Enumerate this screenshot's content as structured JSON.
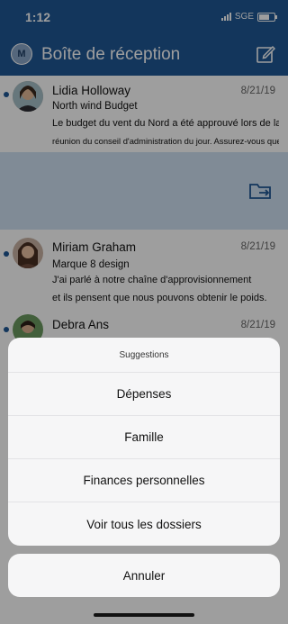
{
  "status_bar": {
    "time": "1:12",
    "carrier": "SGE"
  },
  "header": {
    "title": "Boîte de réception",
    "avatar_initial": "M"
  },
  "mails": [
    {
      "sender": "Lidia Holloway",
      "date": "8/21/19",
      "subject": "North wind Budget",
      "preview_line1": "Le budget du vent du Nord a été approuvé lors de la",
      "preview_line2": "réunion du conseil d'administration du jour. Assurez-vous que le"
    },
    {
      "sender": "Miriam Graham",
      "date": "8/21/19",
      "subject": "Marque 8 design",
      "preview_line1": "J'ai parlé à notre chaîne d'approvisionnement",
      "preview_line2": "et ils pensent que nous pouvons obtenir le poids."
    },
    {
      "sender": "Debra Ans",
      "date": "8/21/19"
    }
  ],
  "sheet": {
    "title": "Suggestions",
    "options": [
      "Dépenses",
      "Famille",
      "Finances personnelles",
      "Voir tous les dossiers"
    ],
    "cancel": "Annuler"
  },
  "icons": {
    "compose": "compose-icon",
    "move": "move-to-folder-icon",
    "signal": "signal-icon",
    "battery": "battery-icon"
  },
  "colors": {
    "header": "#1f5795",
    "swipe_action": "#cfe0f2",
    "unread_dot": "#1f5795"
  }
}
